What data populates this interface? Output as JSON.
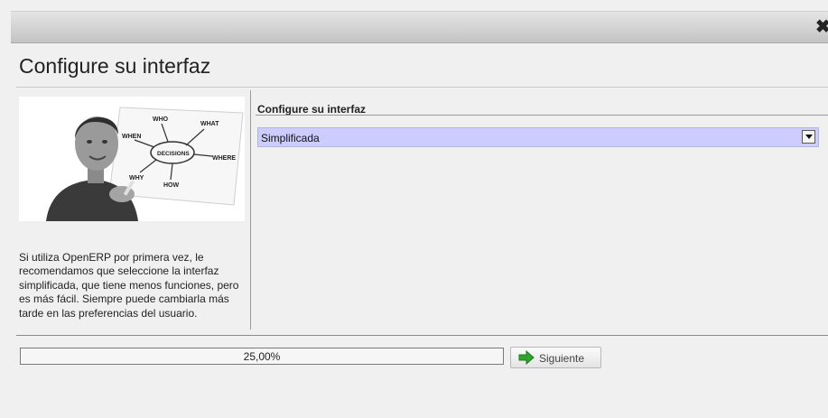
{
  "dialog": {
    "close_icon": "close-icon",
    "title": "Configure su interfaz"
  },
  "left": {
    "illustration_words": [
      "WHO",
      "WHAT",
      "WHEN",
      "WHERE",
      "WHY",
      "HOW",
      "DECISIONS"
    ],
    "help_text": "Si utiliza OpenERP por primera vez, le recomendamos que seleccione la interfaz simplificada, que tiene menos funciones, pero es más fácil. Siempre puede cambiarla más tarde en las preferencias del usuario."
  },
  "form": {
    "section_label": "Configure su interfaz",
    "select": {
      "value": "Simplificada",
      "icon": "dropdown-arrow-icon"
    }
  },
  "footer": {
    "progress": {
      "text": "25,00%",
      "value": 25
    },
    "next_button": {
      "label": "Siguiente",
      "icon": "green-arrow-icon"
    }
  },
  "colors": {
    "select_background": "#ccccff",
    "next_arrow": "#2fa52f"
  }
}
